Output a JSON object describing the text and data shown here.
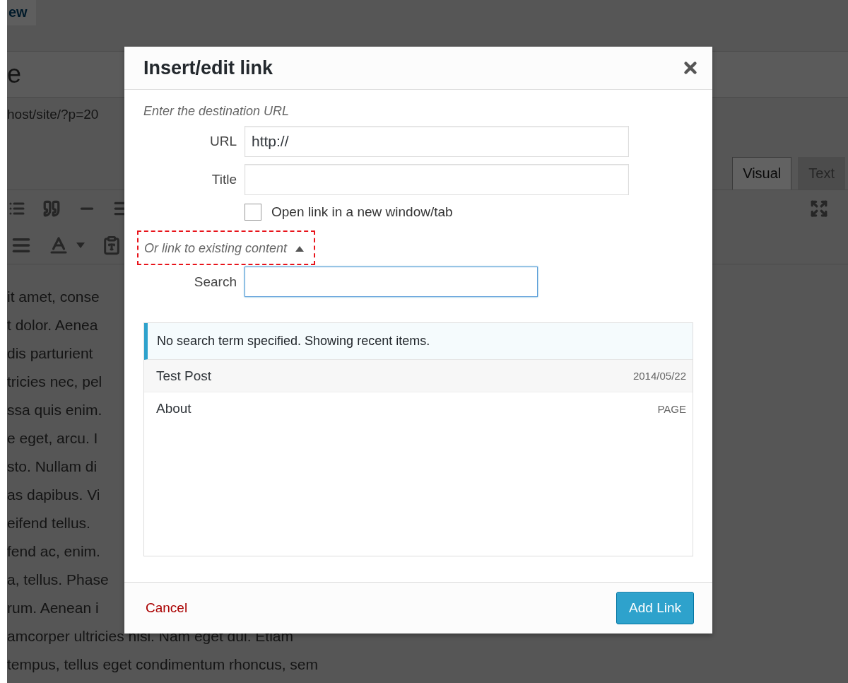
{
  "background_editor": {
    "view_tab": "ew",
    "title_fragment": "e",
    "permalink_fragment": "host/site/?p=20",
    "editor_tabs": [
      {
        "label": "Visual",
        "selected": true
      },
      {
        "label": "Text",
        "selected": false
      }
    ],
    "body_lines": [
      "it amet, conse",
      "t dolor. Aenea",
      "dis parturient",
      "tricies nec, pel",
      "ssa quis enim.",
      "e eget, arcu. I",
      "sto. Nullam di",
      "as dapibus. Vi",
      "eifend tellus.",
      "fend ac, enim.",
      "a, tellus. Phase",
      "rum. Aenean i",
      "amcorper ultricies nisi. Nam eget dui. Etiam",
      "tempus, tellus eget condimentum rhoncus, sem"
    ]
  },
  "dialog": {
    "title": "Insert/edit link",
    "instruction": "Enter the destination URL",
    "fields": [
      {
        "label": "URL",
        "value": "http://"
      },
      {
        "label": "Title"
      }
    ],
    "new_tab": {
      "label": "Open link in a new window/tab",
      "checked": false
    },
    "existing_toggle": {
      "label": "Or link to existing content",
      "expanded": true,
      "highlighted": true
    },
    "search": {
      "label": "Search",
      "focused": true
    },
    "results": {
      "notice": "No search term specified. Showing recent items.",
      "items": [
        {
          "title": "Test Post",
          "info": "2014/05/22",
          "selected": true
        },
        {
          "title": "About",
          "info": "PAGE",
          "selected": false
        }
      ]
    },
    "cancel": "Cancel",
    "submit": "Add Link"
  }
}
